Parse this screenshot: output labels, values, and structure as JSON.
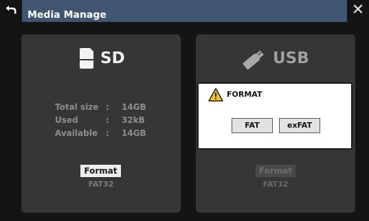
{
  "header": {
    "title": "Media Manage"
  },
  "sd": {
    "label": "SD",
    "info": [
      {
        "key": "Total size",
        "sep": ":",
        "value": "14GB"
      },
      {
        "key": "Used",
        "sep": ":",
        "value": "32kB"
      },
      {
        "key": "Available",
        "sep": ":",
        "value": "14GB"
      }
    ],
    "format_label": "Format",
    "format_type": "FAT32"
  },
  "usb": {
    "label": "USB",
    "format_label": "Format",
    "format_type": "FAT32"
  },
  "popup": {
    "title": "FORMAT",
    "fat_label": "FAT",
    "exfat_label": "exFAT"
  },
  "colors": {
    "titlebar": "#3e5670",
    "panel": "#363636",
    "background": "#141414",
    "warning": "#f5c518"
  },
  "icons": [
    "back-arrow-icon",
    "close-icon",
    "sd-card-icon",
    "usb-stick-icon",
    "warning-icon"
  ]
}
